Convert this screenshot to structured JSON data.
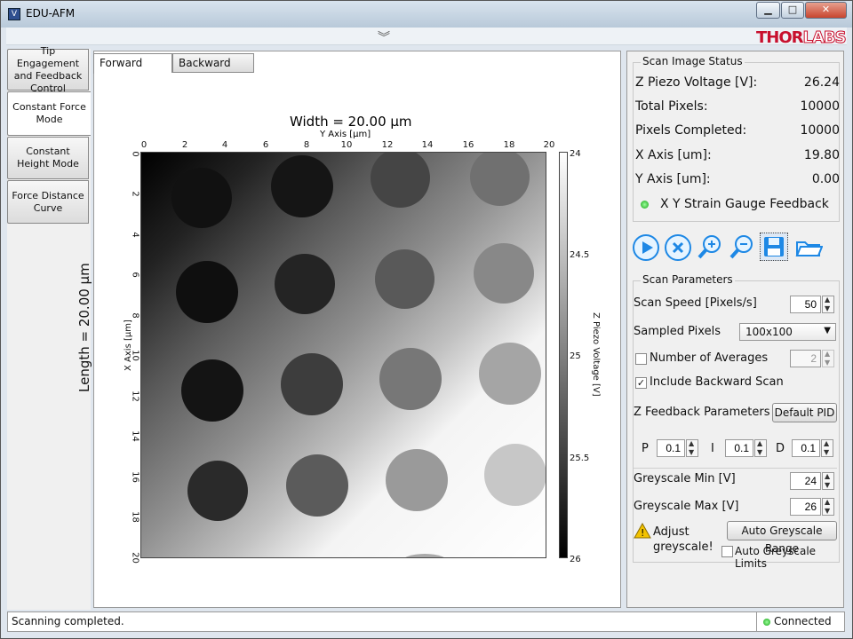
{
  "window": {
    "title": "EDU-AFM",
    "app_icon_glyph": "V",
    "controls": {
      "minimize": "▁",
      "maximize": "□",
      "close": "✕"
    },
    "collapse_icon": "chevron-double-down-icon",
    "collapse_glyph": "︾"
  },
  "brand": {
    "logo_text_red": "THOR",
    "logo_text_outline": "LABS"
  },
  "left_nav": [
    {
      "label": "Tip Engagement and Feedback Control",
      "active": false
    },
    {
      "label": "Constant Force Mode",
      "active": true
    },
    {
      "label": "Constant Height Mode",
      "active": false
    },
    {
      "label": "Force Distance Curve",
      "active": false
    }
  ],
  "scan_tabs": [
    {
      "label": "Forward Scan",
      "active": true
    },
    {
      "label": "Backward Scan",
      "active": false
    }
  ],
  "plot": {
    "width_title": "Width = 20.00 µm",
    "y_axis_label": "Y Axis [µm]",
    "length_title": "Length = 20.00 µm",
    "x_axis_label": "X Axis [µm]",
    "top_ticks": [
      "0",
      "2",
      "4",
      "6",
      "8",
      "10",
      "12",
      "14",
      "16",
      "18",
      "20"
    ],
    "left_ticks": [
      "0",
      "2",
      "4",
      "6",
      "8",
      "10",
      "12",
      "14",
      "16",
      "18",
      "20"
    ],
    "colorbar_ticks": [
      "24",
      "24.5",
      "25",
      "25.5",
      "26"
    ],
    "colorbar_label": "Z Piezo Voltage [V]"
  },
  "scan_status": {
    "title": "Scan  Image Status",
    "items": [
      {
        "label": "Z Piezo Voltage [V]:",
        "value": "26.24"
      },
      {
        "label": "Total Pixels:",
        "value": "10000"
      },
      {
        "label": "Pixels Completed:",
        "value": "10000"
      },
      {
        "label": "X Axis [um]:",
        "value": "19.80"
      },
      {
        "label": "Y Axis [um]:",
        "value": "0.00"
      }
    ],
    "feedback_label": "X Y Strain Gauge Feedback",
    "feedback_color": "#1fb51f"
  },
  "toolbar": {
    "icons": [
      "play-icon",
      "stop-icon",
      "zoom-in-icon",
      "zoom-out-icon",
      "save-icon",
      "open-folder-icon"
    ]
  },
  "scan_parameters": {
    "title": "Scan Parameters",
    "scan_speed_label": "Scan Speed [Pixels/s]",
    "scan_speed_value": "50",
    "sampled_pixels_label": "Sampled Pixels",
    "sampled_pixels_value": "100x100",
    "averages_label": "Number of Averages",
    "averages_value": "2",
    "averages_checked": false,
    "backward_label": "Include Backward Scan",
    "backward_checked": true,
    "z_feedback_label": "Z Feedback Parameters",
    "default_pid_label": "Default PID",
    "p_label": "P",
    "p_value": "0.1",
    "i_label": "I",
    "i_value": "0.1",
    "d_label": "D",
    "d_value": "0.1",
    "grey_min_label": "Greyscale Min [V]",
    "grey_min_value": "24",
    "grey_max_label": "Greyscale Max [V]",
    "grey_max_value": "26",
    "adjust_label": "Adjust greyscale!",
    "auto_range_label": "Auto Greyscale Range",
    "auto_limits_label": "Auto Greyscale Limits",
    "auto_limits_checked": false
  },
  "status_bar": {
    "message": "Scanning completed.",
    "connection": "Connected",
    "connection_color": "#1fb51f"
  }
}
